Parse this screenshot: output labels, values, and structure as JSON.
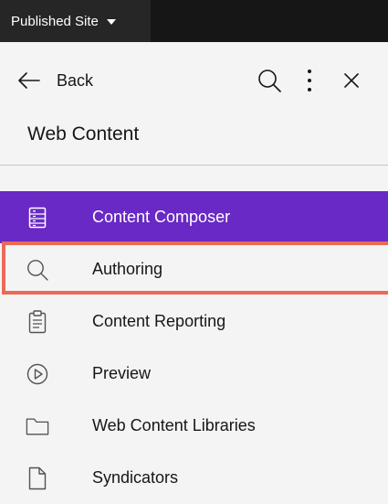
{
  "site_bar": {
    "selected_site": "Published Site"
  },
  "header": {
    "back_label": "Back",
    "title": "Web Content"
  },
  "nav": {
    "items": [
      {
        "label": "Content Composer",
        "icon": "composer-icon",
        "state": "active"
      },
      {
        "label": "Authoring",
        "icon": "search-icon",
        "state": "highlighted"
      },
      {
        "label": "Content Reporting",
        "icon": "clipboard-icon",
        "state": "normal"
      },
      {
        "label": "Preview",
        "icon": "play-circle-icon",
        "state": "normal"
      },
      {
        "label": "Web Content Libraries",
        "icon": "folder-icon",
        "state": "normal"
      },
      {
        "label": "Syndicators",
        "icon": "document-icon",
        "state": "normal"
      }
    ]
  },
  "colors": {
    "active_bg": "#6929c4",
    "highlight_border": "#ea6a56",
    "site_bar_bg": "#161616"
  }
}
